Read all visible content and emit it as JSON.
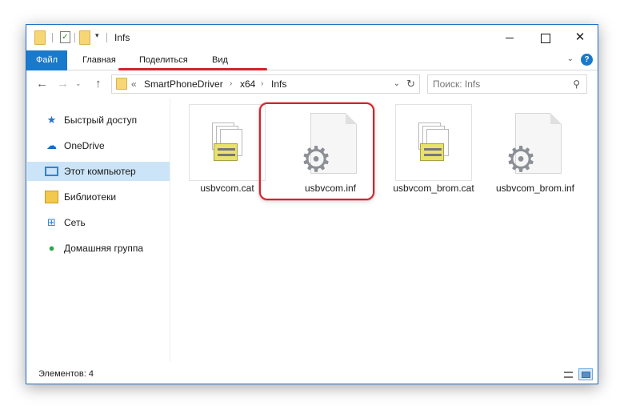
{
  "window": {
    "title": "Infs"
  },
  "ribbon": {
    "tabs": [
      "Файл",
      "Главная",
      "Поделиться",
      "Вид"
    ]
  },
  "address": {
    "overflow": "«",
    "crumbs": [
      "SmartPhoneDriver",
      "x64",
      "Infs"
    ]
  },
  "search": {
    "placeholder": "Поиск: Infs"
  },
  "sidebar": {
    "items": [
      {
        "label": "Быстрый доступ",
        "icon": "star-icon"
      },
      {
        "label": "OneDrive",
        "icon": "cloud-icon"
      },
      {
        "label": "Этот компьютер",
        "icon": "computer-icon",
        "selected": true
      },
      {
        "label": "Библиотеки",
        "icon": "library-icon"
      },
      {
        "label": "Сеть",
        "icon": "network-icon"
      },
      {
        "label": "Домашняя группа",
        "icon": "homegroup-icon"
      }
    ]
  },
  "files": [
    {
      "name": "usbvcom.cat",
      "type": "cat"
    },
    {
      "name": "usbvcom.inf",
      "type": "inf",
      "highlighted": true
    },
    {
      "name": "usbvcom_brom.cat",
      "type": "cat"
    },
    {
      "name": "usbvcom_brom.inf",
      "type": "inf"
    }
  ],
  "status": {
    "count_text": "Элементов: 4"
  },
  "colors": {
    "accent": "#1979ca",
    "selection": "#cce4f7",
    "highlight_red": "#d2232a"
  }
}
